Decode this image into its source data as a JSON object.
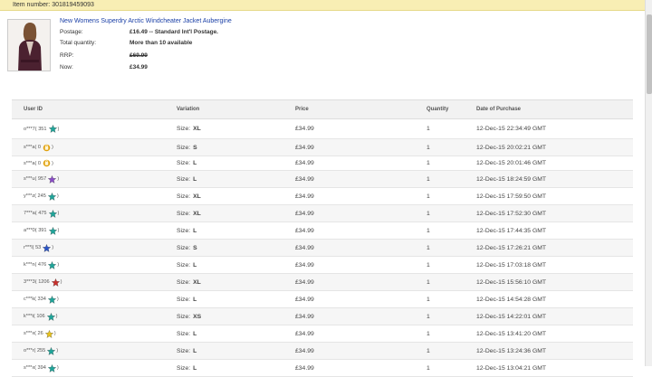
{
  "header": {
    "item_label": "Item number:",
    "item_number": "301819459093"
  },
  "product": {
    "title": "New Womens Superdry Arctic Windcheater Jacket Aubergine",
    "postage_label": "Postage:",
    "postage_value": "£16.49 -- Standard Int'l Postage.",
    "qty_label": "Total quantity:",
    "qty_value": "More than 10 available",
    "rrp_label": "RRP:",
    "rrp_value": "£69.99",
    "now_label": "Now:",
    "now_value": "£34.99"
  },
  "table": {
    "headers": {
      "user": "User ID",
      "variation": "Variation",
      "price": "Price",
      "quantity": "Quantity",
      "date": "Date of Purchase"
    },
    "variation_prefix": "Size:",
    "rows": [
      {
        "user": "o***7",
        "feedback": "351",
        "icon": "teal-star",
        "size": "XL",
        "price": "£34.99",
        "qty": "1",
        "date": "12-Dec-15 22:34:49 GMT"
      },
      {
        "user": "s***a",
        "feedback": "0",
        "icon": "new-user",
        "size": "S",
        "price": "£34.99",
        "qty": "1",
        "date": "12-Dec-15 20:02:21 GMT"
      },
      {
        "user": "s***a",
        "feedback": "0",
        "icon": "new-user",
        "size": "L",
        "price": "£34.99",
        "qty": "1",
        "date": "12-Dec-15 20:01:46 GMT"
      },
      {
        "user": "s***u",
        "feedback": "957",
        "icon": "purple-star",
        "size": "L",
        "price": "£34.99",
        "qty": "1",
        "date": "12-Dec-15 18:24:59 GMT"
      },
      {
        "user": "y***z",
        "feedback": "245",
        "icon": "teal-star",
        "size": "XL",
        "price": "£34.99",
        "qty": "1",
        "date": "12-Dec-15 17:59:50 GMT"
      },
      {
        "user": "7***a",
        "feedback": "475",
        "icon": "teal-star",
        "size": "XL",
        "price": "£34.99",
        "qty": "1",
        "date": "12-Dec-15 17:52:30 GMT"
      },
      {
        "user": "a***0",
        "feedback": "391",
        "icon": "teal-star",
        "size": "L",
        "price": "£34.99",
        "qty": "1",
        "date": "12-Dec-15 17:44:35 GMT"
      },
      {
        "user": "r***l",
        "feedback": "53",
        "icon": "blue-star",
        "size": "S",
        "price": "£34.99",
        "qty": "1",
        "date": "12-Dec-15 17:26:21 GMT"
      },
      {
        "user": "k***n",
        "feedback": "476",
        "icon": "teal-star",
        "size": "L",
        "price": "£34.99",
        "qty": "1",
        "date": "12-Dec-15 17:03:18 GMT"
      },
      {
        "user": "3***3",
        "feedback": "1206",
        "icon": "red-star",
        "size": "XL",
        "price": "£34.99",
        "qty": "1",
        "date": "12-Dec-15 15:56:10 GMT"
      },
      {
        "user": "c***k",
        "feedback": "334",
        "icon": "teal-star",
        "size": "L",
        "price": "£34.99",
        "qty": "1",
        "date": "12-Dec-15 14:54:28 GMT"
      },
      {
        "user": "k***t",
        "feedback": "106",
        "icon": "teal-star",
        "size": "XS",
        "price": "£34.99",
        "qty": "1",
        "date": "12-Dec-15 14:22:01 GMT"
      },
      {
        "user": "s***x",
        "feedback": "26",
        "icon": "yellow-star",
        "size": "L",
        "price": "£34.99",
        "qty": "1",
        "date": "12-Dec-15 13:41:20 GMT"
      },
      {
        "user": "o***r",
        "feedback": "255",
        "icon": "teal-star",
        "size": "L",
        "price": "£34.99",
        "qty": "1",
        "date": "12-Dec-15 13:24:36 GMT"
      },
      {
        "user": "s***x",
        "feedback": "394",
        "icon": "teal-star",
        "size": "L",
        "price": "£34.99",
        "qty": "1",
        "date": "12-Dec-15 13:04:21 GMT"
      }
    ]
  },
  "colors": {
    "teal-star": "#1fa59a",
    "purple-star": "#8a4cc7",
    "blue-star": "#2b55c8",
    "red-star": "#c9302c",
    "yellow-star": "#e8c21b",
    "new-user": "#e0a10e",
    "link": "#1a3fa6",
    "banner": "#f8eeb4"
  }
}
